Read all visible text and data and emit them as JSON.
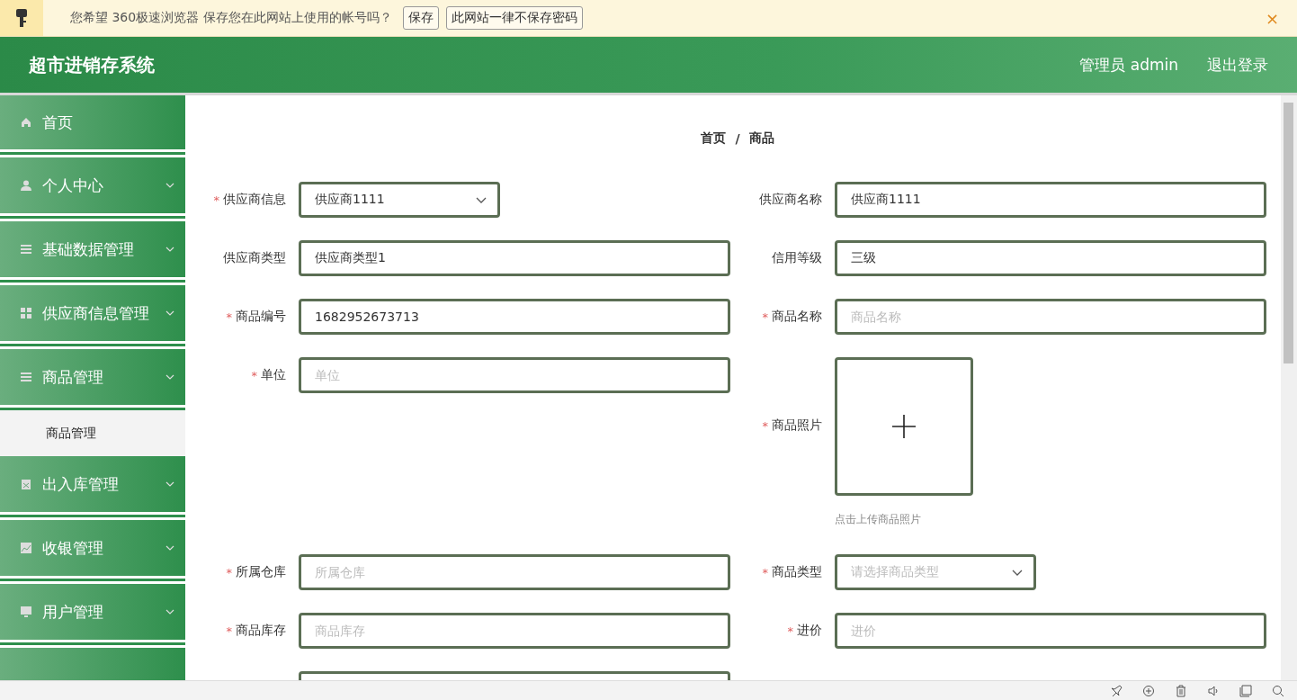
{
  "password_bar": {
    "message": "您希望 360极速浏览器 保存您在此网站上使用的帐号吗？",
    "buttons": [
      "保存",
      "此网站一律不保存密码"
    ],
    "close": "×"
  },
  "header": {
    "title": "超市进销存系统",
    "user": "管理员 admin",
    "logout": "退出登录"
  },
  "sidebar": {
    "items": [
      {
        "label": "首页",
        "kind": "home",
        "chevron": false
      },
      {
        "label": "个人中心",
        "kind": "person",
        "chevron": true
      },
      {
        "label": "基础数据管理",
        "kind": "lines",
        "chevron": true
      },
      {
        "label": "供应商信息管理",
        "kind": "grid",
        "chevron": true
      },
      {
        "label": "商品管理",
        "kind": "lines",
        "chevron": true,
        "children": [
          {
            "label": "商品管理"
          }
        ]
      },
      {
        "label": "出入库管理",
        "kind": "clipboard",
        "chevron": true
      },
      {
        "label": "收银管理",
        "kind": "chart",
        "chevron": true
      },
      {
        "label": "用户管理",
        "kind": "monitor",
        "chevron": true
      },
      {
        "kind": "blank",
        "chevron": false
      }
    ]
  },
  "breadcrumb": {
    "items": [
      "首页",
      "商品"
    ],
    "separator": "/"
  },
  "fields": [
    {
      "label": "供应商信息",
      "required_mark": "*",
      "kind": "select",
      "value": "供应商1111"
    },
    {
      "label": "供应商名称",
      "kind": "text",
      "value": "供应商1111"
    },
    {
      "label": "供应商类型",
      "kind": "text",
      "value": "供应商类型1"
    },
    {
      "label": "信用等级",
      "kind": "text",
      "value": "三级"
    },
    {
      "label": "商品编号",
      "required_mark": "*",
      "kind": "text",
      "value": "1682952673713"
    },
    {
      "label": "商品名称",
      "required_mark": "*",
      "kind": "text",
      "placeholder": "商品名称"
    },
    {
      "label": "单位",
      "required_mark": "*",
      "kind": "text",
      "placeholder": "单位"
    },
    {
      "label": "商品照片",
      "required_mark": "*",
      "kind": "upload",
      "hint": "点击上传商品照片"
    },
    {
      "label": "所属仓库",
      "required_mark": "*",
      "kind": "text",
      "placeholder": "所属仓库"
    },
    {
      "label": "商品类型",
      "required_mark": "*",
      "kind": "select",
      "placeholder": "请选择商品类型"
    },
    {
      "label": "商品库存",
      "required_mark": "*",
      "kind": "text",
      "placeholder": "商品库存"
    },
    {
      "label": "进价",
      "required_mark": "*",
      "kind": "text",
      "placeholder": "进价"
    },
    {
      "kind": "text"
    }
  ]
}
